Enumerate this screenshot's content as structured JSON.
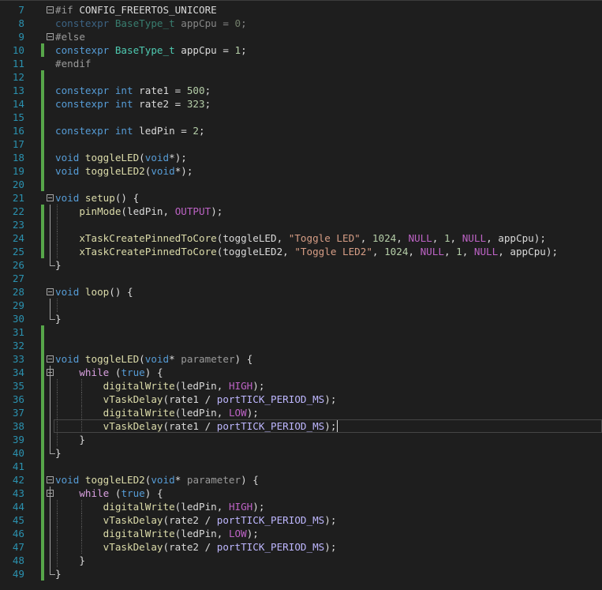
{
  "editor": {
    "lines": [
      {
        "n": "7",
        "fold": "open",
        "changed": false,
        "tokens": [
          [
            "pp",
            "#if "
          ],
          [
            "id",
            "CONFIG_FREERTOS_UNICORE"
          ]
        ]
      },
      {
        "n": "8",
        "fold": "",
        "changed": false,
        "dim": true,
        "tokens": [
          [
            "kw",
            "constexpr "
          ],
          [
            "ty",
            "BaseType_t "
          ],
          [
            "id",
            "appCpu "
          ],
          [
            "pun",
            "= "
          ],
          [
            "num",
            "0"
          ],
          [
            "pun",
            ";"
          ]
        ]
      },
      {
        "n": "9",
        "fold": "open",
        "changed": false,
        "tokens": [
          [
            "pp",
            "#else"
          ]
        ]
      },
      {
        "n": "10",
        "fold": "",
        "changed": true,
        "tokens": [
          [
            "kw",
            "constexpr "
          ],
          [
            "ty",
            "BaseType_t "
          ],
          [
            "id",
            "appCpu "
          ],
          [
            "pun",
            "= "
          ],
          [
            "num",
            "1"
          ],
          [
            "pun",
            ";"
          ]
        ]
      },
      {
        "n": "11",
        "fold": "",
        "changed": false,
        "tokens": [
          [
            "pp",
            "#endif"
          ]
        ]
      },
      {
        "n": "12",
        "fold": "",
        "changed": true,
        "tokens": []
      },
      {
        "n": "13",
        "fold": "",
        "changed": true,
        "tokens": [
          [
            "kw",
            "constexpr "
          ],
          [
            "kw",
            "int "
          ],
          [
            "id",
            "rate1 "
          ],
          [
            "pun",
            "= "
          ],
          [
            "num",
            "500"
          ],
          [
            "pun",
            ";"
          ]
        ]
      },
      {
        "n": "14",
        "fold": "",
        "changed": true,
        "tokens": [
          [
            "kw",
            "constexpr "
          ],
          [
            "kw",
            "int "
          ],
          [
            "id",
            "rate2 "
          ],
          [
            "pun",
            "= "
          ],
          [
            "num",
            "323"
          ],
          [
            "pun",
            ";"
          ]
        ]
      },
      {
        "n": "15",
        "fold": "",
        "changed": true,
        "tokens": []
      },
      {
        "n": "16",
        "fold": "",
        "changed": true,
        "tokens": [
          [
            "kw",
            "constexpr "
          ],
          [
            "kw",
            "int "
          ],
          [
            "id",
            "ledPin "
          ],
          [
            "pun",
            "= "
          ],
          [
            "num",
            "2"
          ],
          [
            "pun",
            ";"
          ]
        ]
      },
      {
        "n": "17",
        "fold": "",
        "changed": true,
        "tokens": []
      },
      {
        "n": "18",
        "fold": "",
        "changed": true,
        "tokens": [
          [
            "kw",
            "void "
          ],
          [
            "fn",
            "toggleLED"
          ],
          [
            "pun",
            "("
          ],
          [
            "kw",
            "void"
          ],
          [
            "pun",
            "*);"
          ]
        ]
      },
      {
        "n": "19",
        "fold": "",
        "changed": true,
        "tokens": [
          [
            "kw",
            "void "
          ],
          [
            "fn",
            "toggleLED2"
          ],
          [
            "pun",
            "("
          ],
          [
            "kw",
            "void"
          ],
          [
            "pun",
            "*);"
          ]
        ]
      },
      {
        "n": "20",
        "fold": "",
        "changed": true,
        "tokens": []
      },
      {
        "n": "21",
        "fold": "open",
        "changed": false,
        "tokens": [
          [
            "kw",
            "void "
          ],
          [
            "fn",
            "setup"
          ],
          [
            "pun",
            "() {"
          ]
        ]
      },
      {
        "n": "22",
        "fold": "",
        "changed": true,
        "bracket": "v",
        "guides": [
          1
        ],
        "tokens": [
          [
            "pun",
            "    "
          ],
          [
            "fn",
            "pinMode"
          ],
          [
            "pun",
            "("
          ],
          [
            "id",
            "ledPin"
          ],
          [
            "pun",
            ", "
          ],
          [
            "mac",
            "OUTPUT"
          ],
          [
            "pun",
            ");"
          ]
        ]
      },
      {
        "n": "23",
        "fold": "",
        "changed": true,
        "bracket": "v",
        "guides": [
          1
        ],
        "tokens": []
      },
      {
        "n": "24",
        "fold": "",
        "changed": true,
        "bracket": "v",
        "guides": [
          1
        ],
        "tokens": [
          [
            "pun",
            "    "
          ],
          [
            "fn",
            "xTaskCreatePinnedToCore"
          ],
          [
            "pun",
            "("
          ],
          [
            "id",
            "toggleLED"
          ],
          [
            "pun",
            ", "
          ],
          [
            "str",
            "\"Toggle LED\""
          ],
          [
            "pun",
            ", "
          ],
          [
            "num",
            "1024"
          ],
          [
            "pun",
            ", "
          ],
          [
            "mac",
            "NULL"
          ],
          [
            "pun",
            ", "
          ],
          [
            "num",
            "1"
          ],
          [
            "pun",
            ", "
          ],
          [
            "mac",
            "NULL"
          ],
          [
            "pun",
            ", "
          ],
          [
            "id",
            "appCpu"
          ],
          [
            "pun",
            ");"
          ]
        ]
      },
      {
        "n": "25",
        "fold": "",
        "changed": true,
        "bracket": "v",
        "guides": [
          1
        ],
        "tokens": [
          [
            "pun",
            "    "
          ],
          [
            "fn",
            "xTaskCreatePinnedToCore"
          ],
          [
            "pun",
            "("
          ],
          [
            "id",
            "toggleLED2"
          ],
          [
            "pun",
            ", "
          ],
          [
            "str",
            "\"Toggle LED2\""
          ],
          [
            "pun",
            ", "
          ],
          [
            "num",
            "1024"
          ],
          [
            "pun",
            ", "
          ],
          [
            "mac",
            "NULL"
          ],
          [
            "pun",
            ", "
          ],
          [
            "num",
            "1"
          ],
          [
            "pun",
            ", "
          ],
          [
            "mac",
            "NULL"
          ],
          [
            "pun",
            ", "
          ],
          [
            "id",
            "appCpu"
          ],
          [
            "pun",
            ");"
          ]
        ]
      },
      {
        "n": "26",
        "fold": "",
        "changed": false,
        "bracket": "end",
        "tokens": [
          [
            "pun",
            "}"
          ]
        ]
      },
      {
        "n": "27",
        "fold": "",
        "changed": false,
        "tokens": []
      },
      {
        "n": "28",
        "fold": "open",
        "changed": false,
        "tokens": [
          [
            "kw",
            "void "
          ],
          [
            "fn",
            "loop"
          ],
          [
            "pun",
            "() {"
          ]
        ]
      },
      {
        "n": "29",
        "fold": "",
        "changed": false,
        "bracket": "v",
        "guides": [
          1
        ],
        "tokens": []
      },
      {
        "n": "30",
        "fold": "",
        "changed": false,
        "bracket": "end",
        "tokens": [
          [
            "pun",
            "}"
          ]
        ]
      },
      {
        "n": "31",
        "fold": "",
        "changed": true,
        "tokens": []
      },
      {
        "n": "32",
        "fold": "",
        "changed": true,
        "tokens": []
      },
      {
        "n": "33",
        "fold": "open",
        "changed": true,
        "tokens": [
          [
            "kw",
            "void "
          ],
          [
            "fn",
            "toggleLED"
          ],
          [
            "pun",
            "("
          ],
          [
            "kw",
            "void"
          ],
          [
            "pun",
            "* "
          ],
          [
            "par",
            "parameter"
          ],
          [
            "pun",
            ") {"
          ]
        ]
      },
      {
        "n": "34",
        "fold": "open2",
        "changed": true,
        "bracket": "v",
        "tokens": [
          [
            "pun",
            "    "
          ],
          [
            "ctl",
            "while "
          ],
          [
            "pun",
            "("
          ],
          [
            "kw",
            "true"
          ],
          [
            "pun",
            ") {"
          ]
        ]
      },
      {
        "n": "35",
        "fold": "",
        "changed": true,
        "bracket": "v",
        "guides": [
          1,
          2
        ],
        "tokens": [
          [
            "pun",
            "        "
          ],
          [
            "fn",
            "digitalWrite"
          ],
          [
            "pun",
            "("
          ],
          [
            "id",
            "ledPin"
          ],
          [
            "pun",
            ", "
          ],
          [
            "mac",
            "HIGH"
          ],
          [
            "pun",
            ");"
          ]
        ]
      },
      {
        "n": "36",
        "fold": "",
        "changed": true,
        "bracket": "v",
        "guides": [
          1,
          2
        ],
        "tokens": [
          [
            "pun",
            "        "
          ],
          [
            "fn",
            "vTaskDelay"
          ],
          [
            "pun",
            "("
          ],
          [
            "id",
            "rate1 "
          ],
          [
            "pun",
            "/ "
          ],
          [
            "mac2",
            "portTICK_PERIOD_MS"
          ],
          [
            "pun",
            ");"
          ]
        ]
      },
      {
        "n": "37",
        "fold": "",
        "changed": true,
        "bracket": "v",
        "guides": [
          1,
          2
        ],
        "tokens": [
          [
            "pun",
            "        "
          ],
          [
            "fn",
            "digitalWrite"
          ],
          [
            "pun",
            "("
          ],
          [
            "id",
            "ledPin"
          ],
          [
            "pun",
            ", "
          ],
          [
            "mac",
            "LOW"
          ],
          [
            "pun",
            ");"
          ]
        ]
      },
      {
        "n": "38",
        "fold": "",
        "changed": true,
        "bracket": "v",
        "guides": [
          1,
          2
        ],
        "current": true,
        "tokens": [
          [
            "pun",
            "        "
          ],
          [
            "fn",
            "vTaskDelay"
          ],
          [
            "pun",
            "("
          ],
          [
            "id",
            "rate1 "
          ],
          [
            "pun",
            "/ "
          ],
          [
            "mac2",
            "portTICK_PERIOD_MS"
          ],
          [
            "pun",
            ");"
          ]
        ]
      },
      {
        "n": "39",
        "fold": "",
        "changed": true,
        "bracket": "v",
        "guides": [
          1
        ],
        "tokens": [
          [
            "pun",
            "    }"
          ]
        ]
      },
      {
        "n": "40",
        "fold": "",
        "changed": true,
        "bracket": "end",
        "tokens": [
          [
            "pun",
            "}"
          ]
        ]
      },
      {
        "n": "41",
        "fold": "",
        "changed": true,
        "tokens": []
      },
      {
        "n": "42",
        "fold": "open",
        "changed": true,
        "tokens": [
          [
            "kw",
            "void "
          ],
          [
            "fn",
            "toggleLED2"
          ],
          [
            "pun",
            "("
          ],
          [
            "kw",
            "void"
          ],
          [
            "pun",
            "* "
          ],
          [
            "par",
            "parameter"
          ],
          [
            "pun",
            ") {"
          ]
        ]
      },
      {
        "n": "43",
        "fold": "open2",
        "changed": true,
        "bracket": "v",
        "tokens": [
          [
            "pun",
            "    "
          ],
          [
            "ctl",
            "while "
          ],
          [
            "pun",
            "("
          ],
          [
            "kw",
            "true"
          ],
          [
            "pun",
            ") {"
          ]
        ]
      },
      {
        "n": "44",
        "fold": "",
        "changed": true,
        "bracket": "v",
        "guides": [
          1,
          2
        ],
        "tokens": [
          [
            "pun",
            "        "
          ],
          [
            "fn",
            "digitalWrite"
          ],
          [
            "pun",
            "("
          ],
          [
            "id",
            "ledPin"
          ],
          [
            "pun",
            ", "
          ],
          [
            "mac",
            "HIGH"
          ],
          [
            "pun",
            ");"
          ]
        ]
      },
      {
        "n": "45",
        "fold": "",
        "changed": true,
        "bracket": "v",
        "guides": [
          1,
          2
        ],
        "tokens": [
          [
            "pun",
            "        "
          ],
          [
            "fn",
            "vTaskDelay"
          ],
          [
            "pun",
            "("
          ],
          [
            "id",
            "rate2 "
          ],
          [
            "pun",
            "/ "
          ],
          [
            "mac2",
            "portTICK_PERIOD_MS"
          ],
          [
            "pun",
            ");"
          ]
        ]
      },
      {
        "n": "46",
        "fold": "",
        "changed": true,
        "bracket": "v",
        "guides": [
          1,
          2
        ],
        "tokens": [
          [
            "pun",
            "        "
          ],
          [
            "fn",
            "digitalWrite"
          ],
          [
            "pun",
            "("
          ],
          [
            "id",
            "ledPin"
          ],
          [
            "pun",
            ", "
          ],
          [
            "mac",
            "LOW"
          ],
          [
            "pun",
            ");"
          ]
        ]
      },
      {
        "n": "47",
        "fold": "",
        "changed": true,
        "bracket": "v",
        "guides": [
          1,
          2
        ],
        "tokens": [
          [
            "pun",
            "        "
          ],
          [
            "fn",
            "vTaskDelay"
          ],
          [
            "pun",
            "("
          ],
          [
            "id",
            "rate2 "
          ],
          [
            "pun",
            "/ "
          ],
          [
            "mac2",
            "portTICK_PERIOD_MS"
          ],
          [
            "pun",
            ");"
          ]
        ]
      },
      {
        "n": "48",
        "fold": "",
        "changed": true,
        "bracket": "v",
        "guides": [
          1
        ],
        "tokens": [
          [
            "pun",
            "    }"
          ]
        ]
      },
      {
        "n": "49",
        "fold": "",
        "changed": true,
        "bracket": "end",
        "tokens": [
          [
            "pun",
            "}"
          ]
        ]
      }
    ]
  },
  "colors": {
    "background": "#1e1e1e",
    "line_number": "#2b91af",
    "change_marker": "#57a64a",
    "keyword": "#569cd6",
    "function": "#dcdcaa",
    "type": "#4ec9b0",
    "number": "#b5cea8",
    "string": "#d69d85",
    "macro": "#bd63c5"
  },
  "icons": {
    "fold_open": "collapse-minus-icon"
  }
}
